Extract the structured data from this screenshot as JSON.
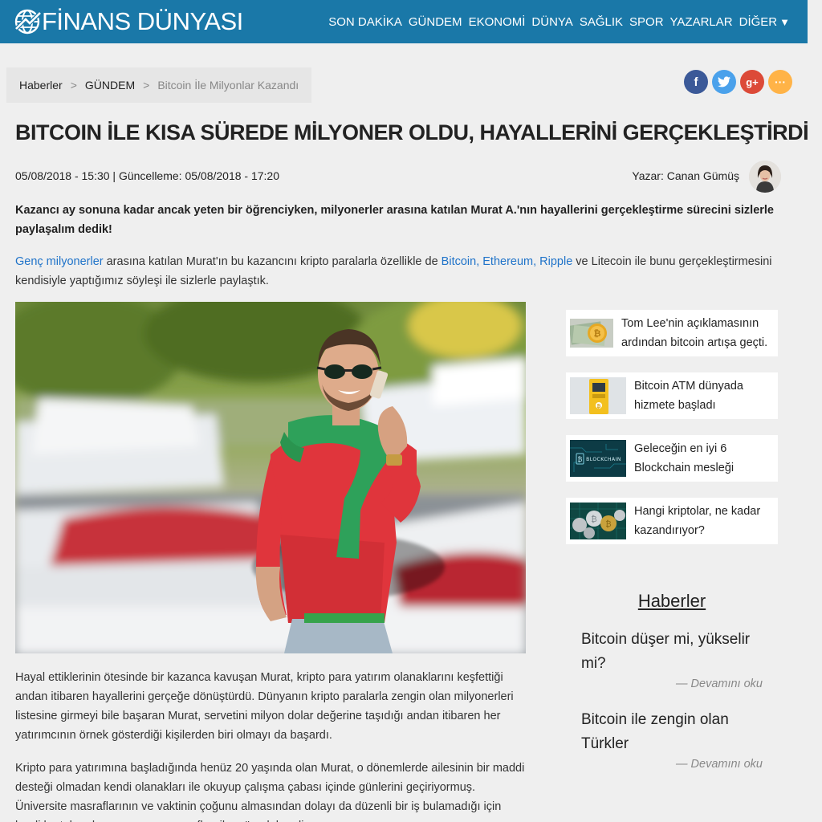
{
  "header": {
    "logo_text": "FİNANS DÜNYASI",
    "nav": [
      "SON DAKİKA",
      "GÜNDEM",
      "EKONOMİ",
      "DÜNYA",
      "SAĞLIK",
      "SPOR",
      "YAZARLAR",
      "DİĞER"
    ],
    "colors": {
      "bar": "#1a78a8"
    }
  },
  "breadcrumb": {
    "items": [
      "Haberler",
      "GÜNDEM"
    ],
    "current": "Bitcoin İle Milyonlar Kazandı",
    "separator": ">"
  },
  "social": {
    "icons": [
      "facebook-icon",
      "twitter-icon",
      "google-plus-icon",
      "more-icon"
    ],
    "glyphs": [
      "f",
      "t",
      "g+",
      "···"
    ]
  },
  "article": {
    "title": "BITCOIN İLE KISA SÜREDE MİLYONER OLDU, HAYALLERİNİ GERÇEKLEŞTİRDİ",
    "published": "05/08/2018 - 15:30 | Güncelleme: 05/08/2018 - 17:20",
    "author": "Yazar: Canan Gümüş",
    "lead": "Kazancı ay sonuna kadar ancak yeten bir öğrenciyken, milyonerler arasına katılan Murat A.'nın hayallerini gerçekleştirme sürecini sizlerle paylaşalım dedik!",
    "intro": {
      "link1": "Genç milyonerler",
      "text1": " arasına katılan Murat'ın bu kazancını kripto paralarla özellikle de ",
      "link2": "Bitcoin, Ethereum, Ripple",
      "text2": " ve Litecoin ile bunu gerçekleştirmesini kendisiyle yaptığımız söyleşi ile sizlerle paylaştık."
    },
    "paragraph1": "Hayal ettiklerinin ötesinde bir kazanca kavuşan Murat, kripto para yatırım olanaklarını keşfettiği andan itibaren hayallerini gerçeğe dönüştürdü. Dünyanın kripto paralarla zengin olan milyonerleri listesine girmeyi bile başaran Murat, servetini milyon dolar değerine taşıdığı andan itibaren her yatırımcının örnek gösterdiği kişilerden biri olmayı da başardı.",
    "paragraph2": "Kripto para yatırımına başladığında henüz 20 yaşında olan Murat, o dönemlerde ailesinin bir maddi desteği olmadan kendi olanakları ile okuyup çalışma çabası içinde günlerini geçiriyormuş. Üniversite masraflarının ve vaktinin çoğunu almasından dolayı da düzenli bir iş bulamadığı için kredi kartı borçları ve yaşam masrafları ile mücadele ediyormuş."
  },
  "sidebar": {
    "cards": [
      {
        "title": "Tom Lee'nin açıklamasının ardından bitcoin artışa geçti."
      },
      {
        "title": "Bitcoin ATM dünyada hizmete başladı"
      },
      {
        "title": "Geleceğin en iyi 6 Blockchain mesleği"
      },
      {
        "title": "Hangi kriptolar, ne kadar kazandırıyor?"
      }
    ],
    "heading": "Haberler",
    "news": [
      {
        "title": "Bitcoin düşer mi, yükselir mi?",
        "more": "— Devamını oku"
      },
      {
        "title": "Bitcoin ile zengin olan Türkler",
        "more": "— Devamını oku"
      }
    ],
    "thumb_label": "BLOCKCHAIN"
  }
}
